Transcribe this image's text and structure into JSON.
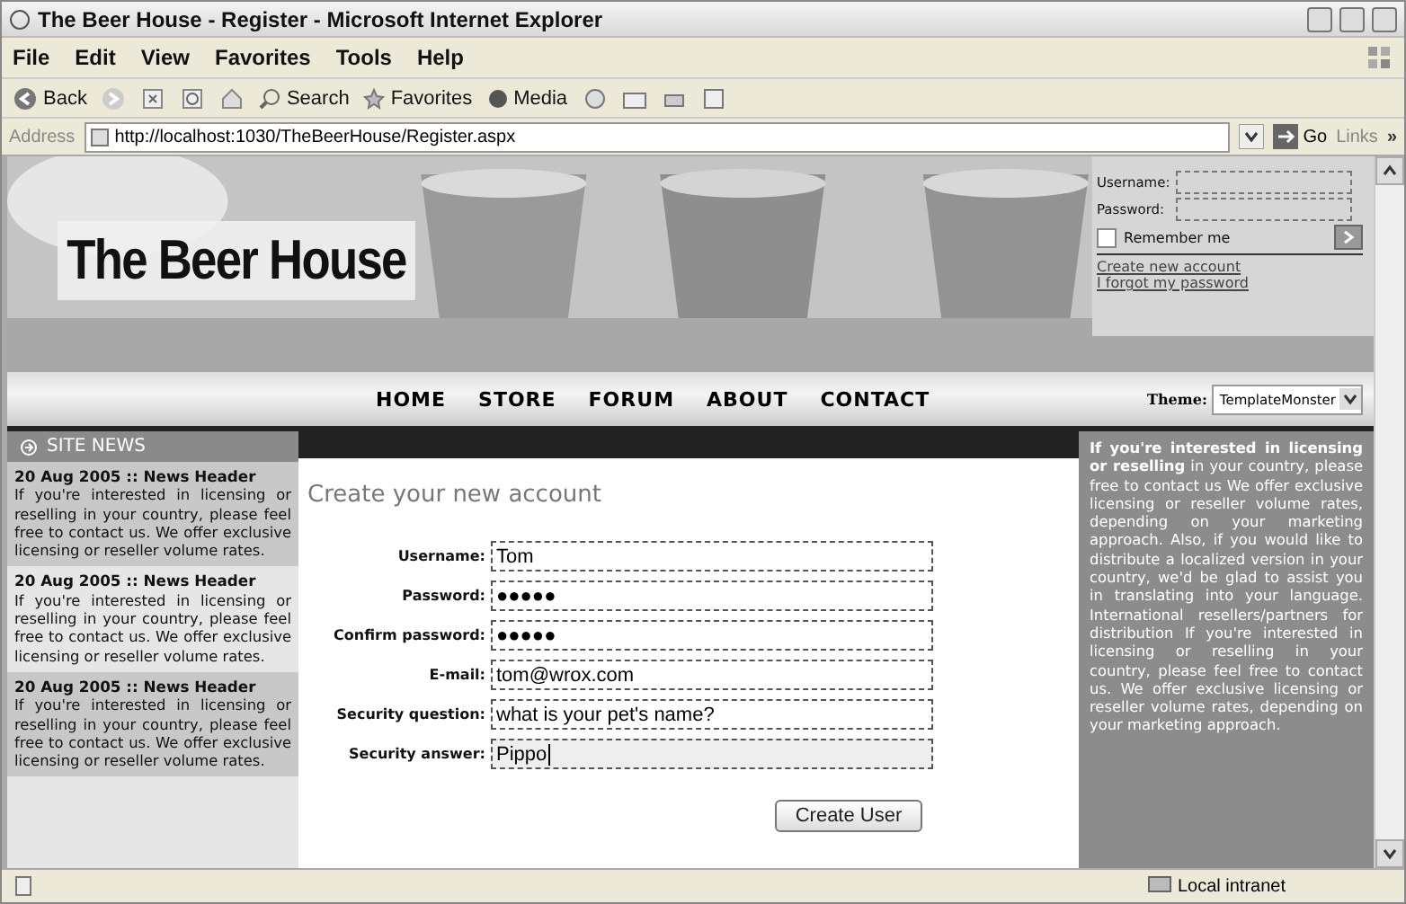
{
  "window": {
    "title": "The Beer House - Register - Microsoft Internet Explorer"
  },
  "menu": [
    "File",
    "Edit",
    "View",
    "Favorites",
    "Tools",
    "Help"
  ],
  "toolbar": {
    "back": "Back",
    "search": "Search",
    "favorites": "Favorites",
    "media": "Media"
  },
  "address": {
    "label": "Address",
    "value": "http://localhost:1030/TheBeerHouse/Register.aspx",
    "go": "Go",
    "links": "Links",
    "more": "»"
  },
  "site": {
    "logo": "The Beer House",
    "login": {
      "username_label": "Username:",
      "password_label": "Password:",
      "remember_label": "Remember me",
      "remember_checked": false,
      "links": [
        "Create new account",
        "I forgot my password"
      ]
    },
    "nav": [
      "HOME",
      "STORE",
      "FORUM",
      "ABOUT",
      "CONTACT"
    ],
    "theme": {
      "label": "Theme:",
      "value": "TemplateMonster"
    }
  },
  "sidebar": {
    "title": "SITE NEWS",
    "items": [
      {
        "header": "20 Aug 2005 :: News Header",
        "body": "If you're interested in licensing or reselling in your country, please feel free to contact us. We offer exclusive licensing or reseller volume rates."
      },
      {
        "header": "20 Aug 2005 :: News Header",
        "body": "If you're interested in licensing or reselling in your country, please feel free to contact us. We offer exclusive licensing or reseller volume rates."
      },
      {
        "header": "20 Aug 2005 :: News Header",
        "body": "If you're interested in licensing or reselling in your country, please feel free to contact us. We offer exclusive licensing or reseller volume rates."
      }
    ]
  },
  "form": {
    "title": "Create your new account",
    "fields": [
      {
        "label": "Username:",
        "value": "Tom",
        "focused": false
      },
      {
        "label": "Password:",
        "value": "●●●●●",
        "focused": false
      },
      {
        "label": "Confirm password:",
        "value": "●●●●●",
        "focused": false
      },
      {
        "label": "E-mail:",
        "value": "tom@wrox.com",
        "focused": false
      },
      {
        "label": "Security question:",
        "value": "what is your pet's name?",
        "focused": false
      },
      {
        "label": "Security answer:",
        "value": "Pippo",
        "focused": true
      }
    ],
    "button": "Create User"
  },
  "right_panel": {
    "text": "**If you're interested in licensing or reselling** in your country, please free to contact us We offer exclusive licensing or reseller volume rates, depending on your marketing approach. Also, if you would like to distribute a localized version in your country, we'd be glad to assist you in translating into your language. International resellers/partners for distribution If you're interested in licensing or reselling in your country, please feel free to contact us. We offer exclusive licensing or reseller volume rates, depending on your marketing approach."
  },
  "status_bar": {
    "zone": "Local intranet"
  }
}
